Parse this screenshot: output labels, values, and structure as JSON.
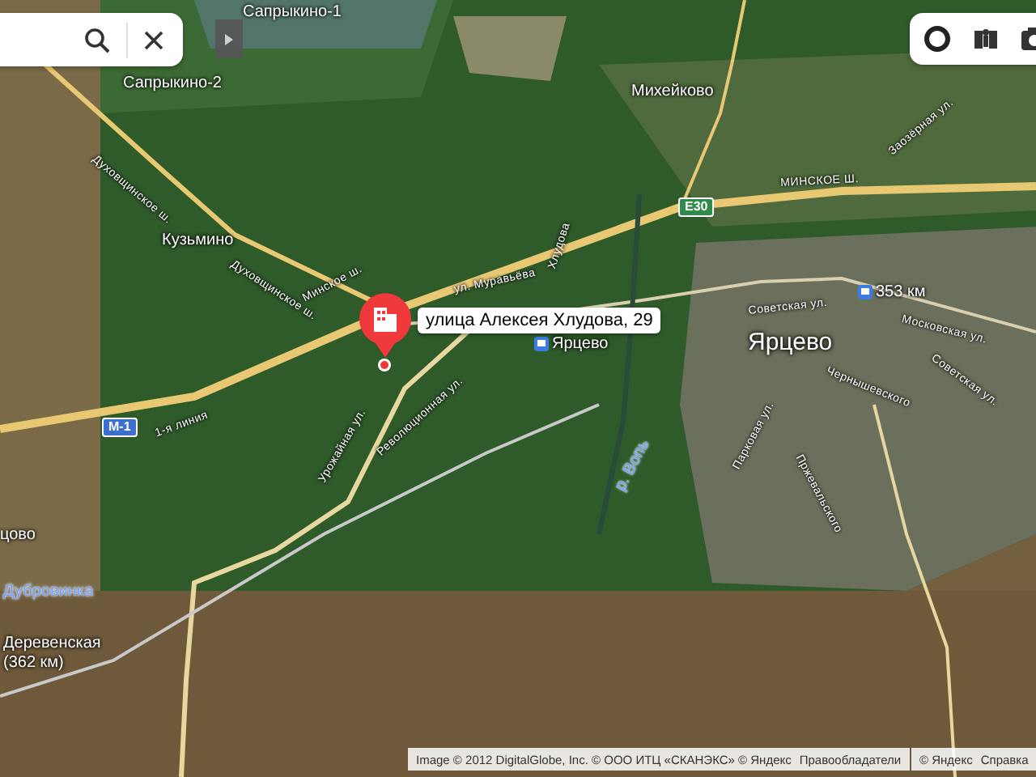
{
  "map": {
    "labels": [
      {
        "text": "Сапрыкино-1",
        "kind": "village"
      },
      {
        "text": "Сапрыкино-2",
        "kind": "village"
      },
      {
        "text": "Михейково",
        "kind": "village"
      },
      {
        "text": "Кузьмино",
        "kind": "village"
      },
      {
        "text": "Ярцево",
        "kind": "town"
      },
      {
        "text": "цово",
        "kind": "village"
      },
      {
        "text": "Дубровинка",
        "kind": "water"
      },
      {
        "text": "Деревенская",
        "kind": "village"
      },
      {
        "text": "(362 км)",
        "kind": "village"
      },
      {
        "text": "р. Вопь",
        "kind": "water"
      },
      {
        "text": "Духовщинское ш.",
        "kind": "road"
      },
      {
        "text": "Духовщинское ш.",
        "kind": "road"
      },
      {
        "text": "Минское ш.",
        "kind": "road"
      },
      {
        "text": "МИНСКОЕ Ш.",
        "kind": "road"
      },
      {
        "text": "ул. Муравьёва",
        "kind": "road"
      },
      {
        "text": "Революционная ул.",
        "kind": "road"
      },
      {
        "text": "Урожайная ул.",
        "kind": "road"
      },
      {
        "text": "1-я линия",
        "kind": "road"
      },
      {
        "text": "Советская ул.",
        "kind": "road"
      },
      {
        "text": "Московская ул.",
        "kind": "road"
      },
      {
        "text": "Хлудова",
        "kind": "road"
      },
      {
        "text": "Заозёрная ул.",
        "kind": "road"
      },
      {
        "text": "Советская ул.",
        "kind": "road"
      },
      {
        "text": "Чернышевского",
        "kind": "road"
      },
      {
        "text": "Пржевальского",
        "kind": "road"
      },
      {
        "text": "Парковая ул.",
        "kind": "road"
      }
    ],
    "shields": [
      {
        "text": "E30",
        "color": "#2f8a4c"
      },
      {
        "text": "M-1",
        "color": "#3d6fcf"
      }
    ],
    "stations": [
      {
        "text": "Ярцево"
      },
      {
        "text": "353 км"
      }
    ],
    "marker": {
      "address": "улица Алексея Хлудова, 29"
    }
  },
  "copyright": {
    "text": "Image © 2012 DigitalGlobe, Inc. © ООО ИТЦ «СКАНЭКС» © Яндекс",
    "link": "Правообладатели"
  },
  "footer": {
    "text": "© Яндекс",
    "link": "Справка"
  }
}
